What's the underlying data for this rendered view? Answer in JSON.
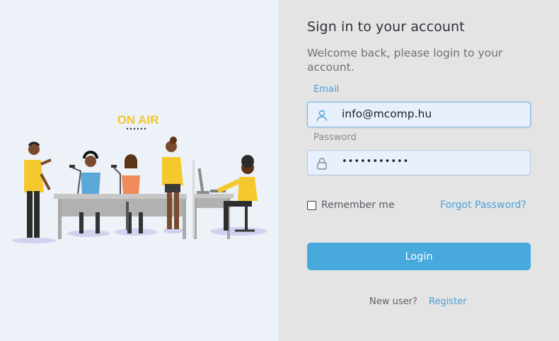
{
  "illustration": {
    "sign_text": "ON AIR"
  },
  "login": {
    "title": "Sign in to your account",
    "subtitle": "Welcome back, please login to your account.",
    "email_label": "Email",
    "email_value": "info@mcomp.hu",
    "password_label": "Password",
    "password_masked": "•••••••••••",
    "remember_label": "Remember me",
    "forgot_label": "Forgot Password?",
    "login_button": "Login",
    "new_user_text": "New user?",
    "register_link": "Register"
  },
  "icons": {
    "email_field": "user-icon",
    "password_field": "lock-icon"
  },
  "colors": {
    "accent": "#47a9dc",
    "link": "#4a9fd6",
    "panel_bg": "#e4e4e4",
    "illus_bg": "#edf1f8"
  }
}
